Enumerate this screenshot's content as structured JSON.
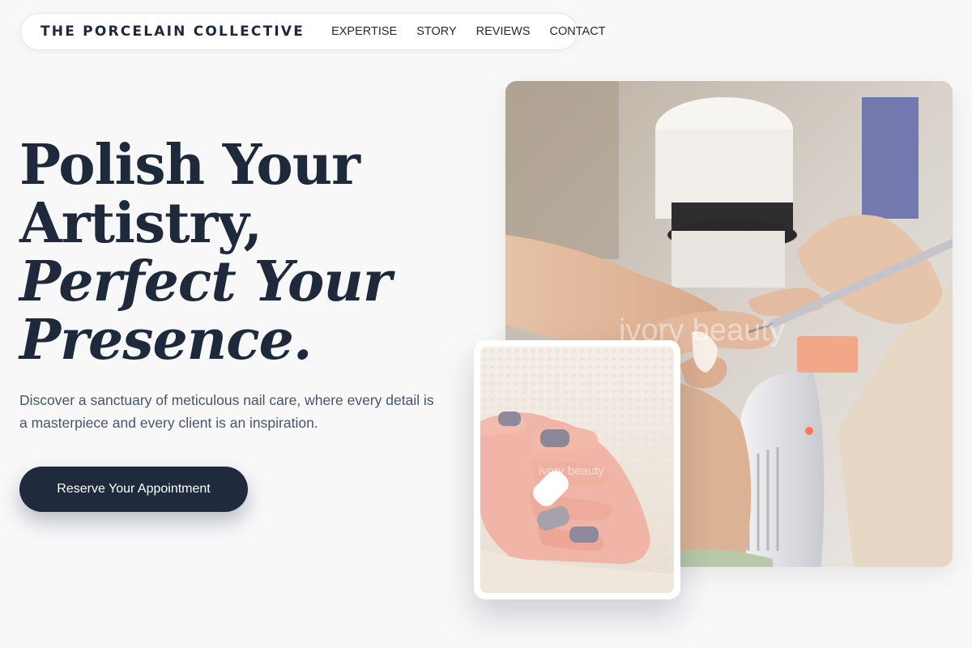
{
  "nav": {
    "brand": "THE PORCELAIN COLLECTIVE",
    "links": [
      "EXPERTISE",
      "STORY",
      "REVIEWS",
      "CONTACT"
    ]
  },
  "hero": {
    "title_line1": "Polish Your",
    "title_line2": "Artistry,",
    "title_line3": "Perfect Your",
    "title_line4": "Presence.",
    "description": "Discover a sanctuary of meticulous nail care, where every detail is a masterpiece and every client is an inspiration.",
    "cta_label": "Reserve Your Appointment"
  },
  "images": {
    "main_watermark": "ivory beauty",
    "small_watermark": "ivory beauty"
  },
  "colors": {
    "brand_navy": "#1f2a3d",
    "background": "#f8f8f9",
    "body_text": "#475569"
  }
}
